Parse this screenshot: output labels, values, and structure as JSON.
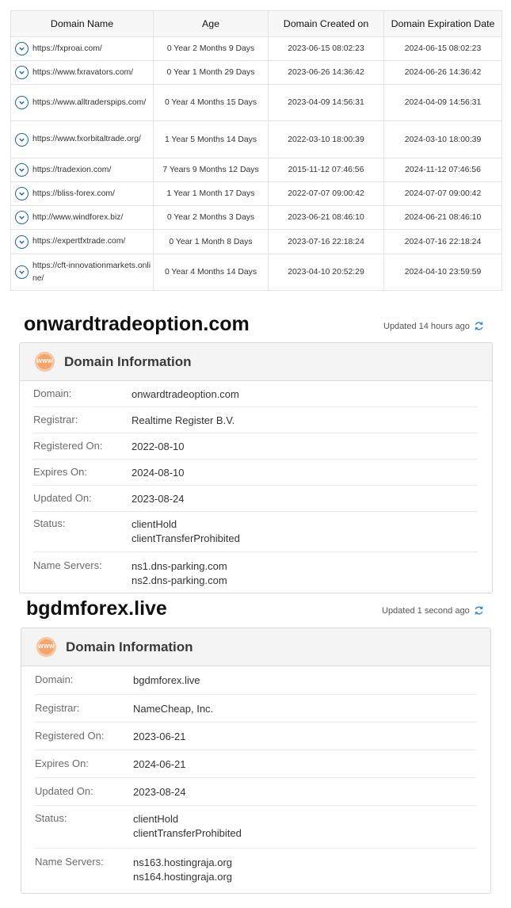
{
  "table": {
    "headers": [
      "Domain Name",
      "Age",
      "Domain Created on",
      "Domain Expiration Date"
    ],
    "rows": [
      {
        "domain": "https://fxproai.com/",
        "age": "0 Year 2 Months 9 Days",
        "created": "2023-06-15 08:02:23",
        "expires": "2024-06-15 08:02:23"
      },
      {
        "domain": "https://www.fxravators.com/",
        "age": "0 Year 1 Month 29 Days",
        "created": "2023-06-26 14:36:42",
        "expires": "2024-06-26 14:36:42"
      },
      {
        "domain": "https://www.alltraderspips.com/",
        "age": "0 Year 4 Months 15 Days",
        "created": "2023-04-09 14:56:31",
        "expires": "2024-04-09 14:56:31"
      },
      {
        "domain": "https://www.fxorbitaltrade.org/",
        "age": "1 Year 5 Months 14 Days",
        "created": "2022-03-10 18:00:39",
        "expires": "2024-03-10 18:00:39"
      },
      {
        "domain": "https://tradexion.com/",
        "age": "7 Years 9 Months 12 Days",
        "created": "2015-11-12 07:46:56",
        "expires": "2024-11-12 07:46:56"
      },
      {
        "domain": "https://bliss-forex.com/",
        "age": "1 Year 1 Month 17 Days",
        "created": "2022-07-07 09:00:42",
        "expires": "2024-07-07 09:00:42"
      },
      {
        "domain": "http://www.windforex.biz/",
        "age": "0 Year 2 Months 3 Days",
        "created": "2023-06-21 08:46:10",
        "expires": "2024-06-21 08:46:10"
      },
      {
        "domain": "https://expertfxtrade.com/",
        "age": "0 Year 1 Month 8 Days",
        "created": "2023-07-16 22:18:24",
        "expires": "2024-07-16 22:18:24"
      },
      {
        "domain": "https://cft-innovationmarkets.online/",
        "age": "0 Year 4 Months 14 Days",
        "created": "2023-04-10 20:52:29",
        "expires": "2024-04-10 23:59:59"
      }
    ]
  },
  "blocks": [
    {
      "title": "onwardtradeoption.com",
      "updated": "Updated 14 hours ago",
      "card_title": "Domain Information",
      "fields": [
        {
          "label": "Domain:",
          "values": [
            "onwardtradeoption.com"
          ]
        },
        {
          "label": "Registrar:",
          "values": [
            "Realtime Register B.V."
          ]
        },
        {
          "label": "Registered On:",
          "values": [
            "2022-08-10"
          ]
        },
        {
          "label": "Expires On:",
          "values": [
            "2024-08-10"
          ]
        },
        {
          "label": "Updated On:",
          "values": [
            "2023-08-24"
          ]
        },
        {
          "label": "Status:",
          "values": [
            "clientHold",
            "clientTransferProhibited"
          ]
        },
        {
          "label": "Name Servers:",
          "values": [
            "ns1.dns-parking.com",
            "ns2.dns-parking.com"
          ]
        }
      ]
    },
    {
      "title": "bgdmforex.live",
      "updated": "Updated 1 second ago",
      "card_title": "Domain Information",
      "fields": [
        {
          "label": "Domain:",
          "values": [
            "bgdmforex.live"
          ]
        },
        {
          "label": "Registrar:",
          "values": [
            "NameCheap, Inc."
          ]
        },
        {
          "label": "Registered On:",
          "values": [
            "2023-06-21"
          ]
        },
        {
          "label": "Expires On:",
          "values": [
            "2024-06-21"
          ]
        },
        {
          "label": "Updated On:",
          "values": [
            "2023-08-24"
          ]
        },
        {
          "label": "Status:",
          "values": [
            "clientHold",
            "clientTransferProhibited"
          ]
        },
        {
          "label": "Name Servers:",
          "values": [
            "ns163.hostingraja.org",
            "ns164.hostingraja.org"
          ]
        }
      ]
    }
  ],
  "icons": {
    "row_toggle": "chevron-down-circle-icon",
    "card_header": "www-globe-icon",
    "refresh": "refresh-icon"
  },
  "colors": {
    "chevron": "#2463a8",
    "refresh": "#3a8fd6",
    "www_badge": "#f3a46d"
  }
}
